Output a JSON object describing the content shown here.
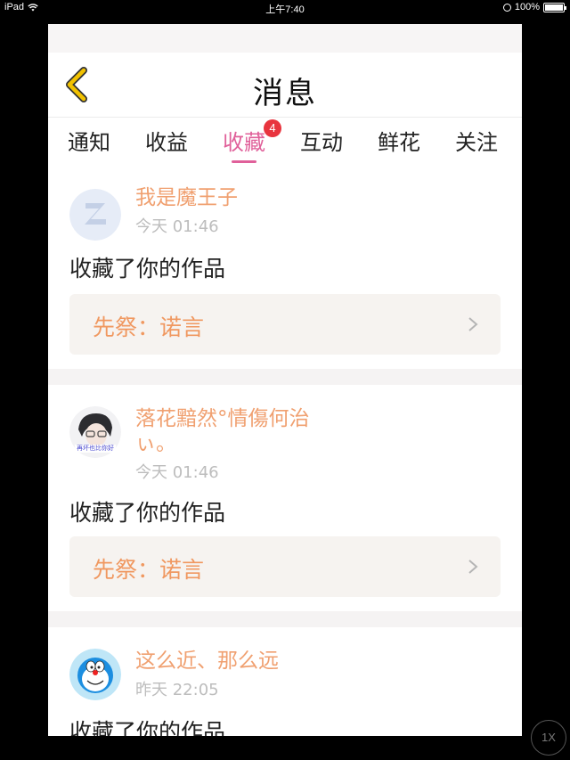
{
  "status_bar": {
    "device": "iPad",
    "time": "上午7:40",
    "battery": "100%"
  },
  "header": {
    "title": "消息"
  },
  "tabs": [
    {
      "label": "通知"
    },
    {
      "label": "收益"
    },
    {
      "label": "收藏",
      "badge": "4",
      "active": true
    },
    {
      "label": "互动"
    },
    {
      "label": "鲜花"
    },
    {
      "label": "关注"
    }
  ],
  "notifications": [
    {
      "user": "我是魔王子",
      "time": "今天 01:46",
      "action": "收藏了你的作品",
      "work": "先祭：诺言"
    },
    {
      "user": "落花黯然°情傷何治ぃ。",
      "time": "今天 01:46",
      "action": "收藏了你的作品",
      "work": "先祭：诺言",
      "avatar_text": "再坏也比你好"
    },
    {
      "user": "这么近、那么远",
      "time": "昨天 22:05",
      "action": "收藏了你的作品"
    }
  ],
  "zoom_button": "1X",
  "colors": {
    "accent_pink": "#e0609a",
    "username_orange": "#f0a070",
    "work_title_orange": "#f09860",
    "badge_red": "#e8343e",
    "back_arrow": "#f2c200"
  }
}
